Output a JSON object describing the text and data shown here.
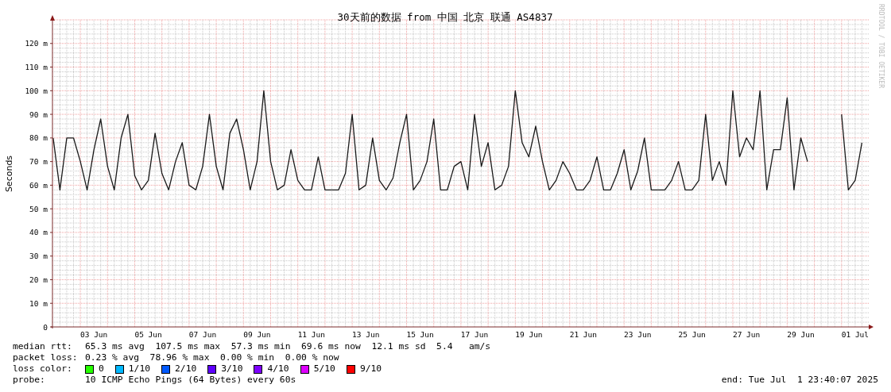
{
  "credit": "RRDTOOL / TOBI OETIKER",
  "chart_data": {
    "type": "line",
    "title": "30天前的数据 from 中国 北京 联通 AS4837",
    "ylabel": "Seconds",
    "ylim": [
      0,
      130
    ],
    "grid": true,
    "categories": [
      null,
      null,
      null,
      null,
      null,
      null,
      "03 Jun",
      null,
      null,
      null,
      null,
      null,
      null,
      null,
      "05 Jun",
      null,
      null,
      null,
      null,
      null,
      null,
      null,
      "07 Jun",
      null,
      null,
      null,
      null,
      null,
      null,
      null,
      "09 Jun",
      null,
      null,
      null,
      null,
      null,
      null,
      null,
      "11 Jun",
      null,
      null,
      null,
      null,
      null,
      null,
      null,
      "13 Jun",
      null,
      null,
      null,
      null,
      null,
      null,
      null,
      "15 Jun",
      null,
      null,
      null,
      null,
      null,
      null,
      null,
      "17 Jun",
      null,
      null,
      null,
      null,
      null,
      null,
      null,
      "19 Jun",
      null,
      null,
      null,
      null,
      null,
      null,
      null,
      "21 Jun",
      null,
      null,
      null,
      null,
      null,
      null,
      null,
      "23 Jun",
      null,
      null,
      null,
      null,
      null,
      null,
      null,
      "25 Jun",
      null,
      null,
      null,
      null,
      null,
      null,
      null,
      "27 Jun",
      null,
      null,
      null,
      null,
      null,
      null,
      null,
      "29 Jun",
      null,
      null,
      null,
      null,
      null,
      null,
      null,
      "01 Jul",
      null
    ],
    "yticks": [
      {
        "value": 120,
        "label": "120 m"
      },
      {
        "value": 110,
        "label": "110 m"
      },
      {
        "value": 100,
        "label": "100 m"
      },
      {
        "value": 90,
        "label": "90 m"
      },
      {
        "value": 80,
        "label": "80 m"
      },
      {
        "value": 70,
        "label": "70 m"
      },
      {
        "value": 60,
        "label": "60 m"
      },
      {
        "value": 50,
        "label": "50 m"
      },
      {
        "value": 40,
        "label": "40 m"
      },
      {
        "value": 30,
        "label": "30 m"
      },
      {
        "value": 20,
        "label": "20 m"
      },
      {
        "value": 10,
        "label": "10 m"
      },
      {
        "value": 0,
        "label": "0"
      }
    ],
    "series": [
      {
        "color": "#1a1a1a",
        "values": [
          80,
          58,
          80,
          80,
          70,
          58,
          75,
          88,
          68,
          58,
          80,
          90,
          64,
          58,
          62,
          82,
          65,
          58,
          70,
          78,
          60,
          58,
          68,
          90,
          68,
          58,
          82,
          88,
          75,
          58,
          70,
          100,
          70,
          58,
          60,
          75,
          62,
          58,
          58,
          72,
          58,
          58,
          58,
          65,
          90,
          58,
          60,
          80,
          62,
          58,
          63,
          78,
          90,
          58,
          62,
          70,
          88,
          58,
          58,
          68,
          70,
          58,
          90,
          68,
          78,
          58,
          60,
          68,
          100,
          78,
          72,
          85,
          70,
          58,
          62,
          70,
          65,
          58,
          58,
          62,
          72,
          58,
          58,
          65,
          75,
          58,
          66,
          80,
          58,
          58,
          58,
          62,
          70,
          58,
          58,
          62,
          90,
          62,
          70,
          60,
          100,
          72,
          80,
          75,
          100,
          58,
          75,
          75,
          97,
          58,
          80,
          70,
          null,
          null,
          null,
          null,
          90,
          58,
          62,
          78
        ]
      }
    ]
  },
  "legend_lines": [
    {
      "kind": "stats",
      "label": "median rtt:",
      "value": "65.3 ms avg  107.5 ms max  57.3 ms min  69.6 ms now  12.1 ms sd  5.4   am/s"
    },
    {
      "kind": "stats",
      "label": "packet loss:",
      "value": "0.23 % avg  78.96 % max  0.00 % min  0.00 % now"
    },
    {
      "kind": "swatches",
      "label": "loss color:",
      "items": [
        {
          "label": "0",
          "color": "#26ff00"
        },
        {
          "label": "1/10",
          "color": "#00b8ff"
        },
        {
          "label": "2/10",
          "color": "#0059ff"
        },
        {
          "label": "3/10",
          "color": "#5e00ff"
        },
        {
          "label": "4/10",
          "color": "#7e00ff"
        },
        {
          "label": "5/10",
          "color": "#dd00ff"
        },
        {
          "label": "9/10",
          "color": "#ff0000"
        }
      ]
    },
    {
      "kind": "probe",
      "label": "probe:",
      "value": "10 ICMP Echo Pings (64 Bytes) every 60s",
      "end": "end: Tue Jul  1 23:40:07 2025"
    }
  ]
}
